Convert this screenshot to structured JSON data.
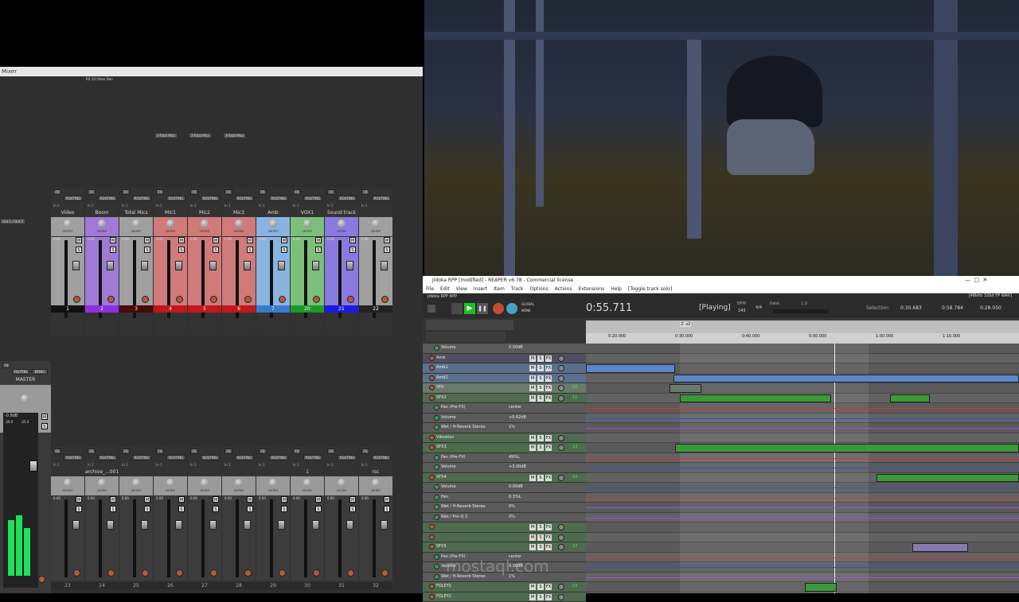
{
  "mixer": {
    "title": "Mixer",
    "fx_label": "FX",
    "routing_label": "ROUTING",
    "mono_label": "MONO",
    "input_label": "In 1",
    "top_strip_labels": [
      "RX 10 Video Den"
    ],
    "send_labels": [
      "3-Total Mics",
      "3-Total Mics",
      "3-Total Mics"
    ],
    "out_label": "Out 1 / Out 2",
    "pan_label": "center",
    "gain": "0.00",
    "mute": "M",
    "solo": "S",
    "master_label": "MASTER",
    "tracks_top": [
      {
        "name": "Video",
        "num": "1",
        "color": "#a0a0a0",
        "numbg": "#111"
      },
      {
        "name": "Boom",
        "num": "2",
        "color": "#a07ad6",
        "numbg": "#8e2fe0"
      },
      {
        "name": "Total Mics",
        "num": "3",
        "color": "#a0a0a0",
        "numbg": "#4a0a0a"
      },
      {
        "name": "Mic1",
        "num": "4",
        "color": "#d07a7a",
        "numbg": "#c01818"
      },
      {
        "name": "Mic2",
        "num": "5",
        "color": "#d07a7a",
        "numbg": "#c01818"
      },
      {
        "name": "Mic3",
        "num": "6",
        "color": "#d07a7a",
        "numbg": "#c01818"
      },
      {
        "name": "Amb",
        "num": "7",
        "color": "#8ab4e0",
        "numbg": "#3a7ad0"
      },
      {
        "name": "VOX1",
        "num": "20",
        "color": "#7ac07a",
        "numbg": "#1a9a2a"
      },
      {
        "name": "Sound track",
        "num": "21",
        "color": "#8a7ae0",
        "numbg": "#1a1ae0"
      },
      {
        "name": "",
        "num": "22",
        "color": "#a0a0a0",
        "numbg": "#222"
      }
    ],
    "tracks_bottom": [
      {
        "name": "",
        "num": "23"
      },
      {
        "name": "archive_...001",
        "num": "24"
      },
      {
        "name": "",
        "num": "25"
      },
      {
        "name": "",
        "num": "26"
      },
      {
        "name": "",
        "num": "27"
      },
      {
        "name": "",
        "num": "28"
      },
      {
        "name": "",
        "num": "29"
      },
      {
        "name": "1",
        "num": "30"
      },
      {
        "name": "",
        "num": "31"
      },
      {
        "name": "rsc",
        "num": "32"
      }
    ],
    "master_readouts": [
      "-0.8dB",
      "-26.0",
      "-25.4"
    ]
  },
  "reaper": {
    "title": "Jidoka RPP [modified] - REAPER v6.78 - Commercial license",
    "menu": [
      "File",
      "Edit",
      "View",
      "Insert",
      "Item",
      "Track",
      "Options",
      "Actions",
      "Extensions",
      "Help",
      "[Toggle track solo]"
    ],
    "tab": "Jidoka RPP RPP",
    "status_right": "[48kHz 32bit FP WAV]",
    "time": "0:55.711",
    "state": "[Playing]",
    "bpm_label": "BPM",
    "bpm": "143",
    "sig": "4/4",
    "rate_label": "Rate:",
    "rate": "1.0",
    "selection_label": "Selection:",
    "sel_start": "0:30.683",
    "sel_end": "0:58.784",
    "sel_len": "0:28.050",
    "global_label": "GLOBAL",
    "none_label": "NONE",
    "ruler": [
      "0:20.000",
      "0:30.000",
      "0:40.000",
      "0:50.000",
      "1:00.000",
      "1:10.000"
    ],
    "marker": "2: s2",
    "tracks": [
      {
        "name": "Volume",
        "val": "0.00dB",
        "kind": "env"
      },
      {
        "name": "Amb",
        "kind": "folder"
      },
      {
        "name": "Amb1",
        "kind": "track"
      },
      {
        "name": "Amb2",
        "kind": "track"
      },
      {
        "name": "SFX",
        "kind": "folder",
        "num": "10"
      },
      {
        "name": "SFX2",
        "kind": "track",
        "num": "11"
      },
      {
        "name": "Pan (Pre-FX)",
        "val": "center",
        "kind": "env"
      },
      {
        "name": "Volume",
        "val": "+0.62dB",
        "kind": "env"
      },
      {
        "name": "Wet / H-Reverb Stereo",
        "val": "1%",
        "kind": "env"
      },
      {
        "name": "Vibration",
        "kind": "track"
      },
      {
        "name": "SFX3",
        "kind": "track",
        "num": "13"
      },
      {
        "name": "Pan (Pre-FX)",
        "val": "49%L",
        "kind": "env"
      },
      {
        "name": "Volume",
        "val": "+3.00dB",
        "kind": "env"
      },
      {
        "name": "SFX4",
        "kind": "track",
        "num": "14"
      },
      {
        "name": "Volume",
        "val": "0.00dB",
        "kind": "env"
      },
      {
        "name": "Pan",
        "val": "0.3%L",
        "kind": "env"
      },
      {
        "name": "Wet / H-Reverb Stereo",
        "val": "6%",
        "kind": "env"
      },
      {
        "name": "Wet / Pro-Q 3",
        "val": "0%",
        "kind": "env"
      },
      {
        "name": "",
        "kind": "track"
      },
      {
        "name": "",
        "kind": "track"
      },
      {
        "name": "SFX5",
        "kind": "track",
        "num": "17"
      },
      {
        "name": "Pan (Pre-FX)",
        "val": "center",
        "kind": "env"
      },
      {
        "name": "Volume",
        "val": "0.00dB",
        "kind": "env"
      },
      {
        "name": "Wet / H-Reverb Stereo",
        "val": "1%",
        "kind": "env"
      },
      {
        "name": "FOLEY1",
        "kind": "track",
        "num": "19"
      },
      {
        "name": "FOLEY2",
        "kind": "track"
      }
    ]
  },
  "watermark": {
    "text": "mostaql.com"
  }
}
